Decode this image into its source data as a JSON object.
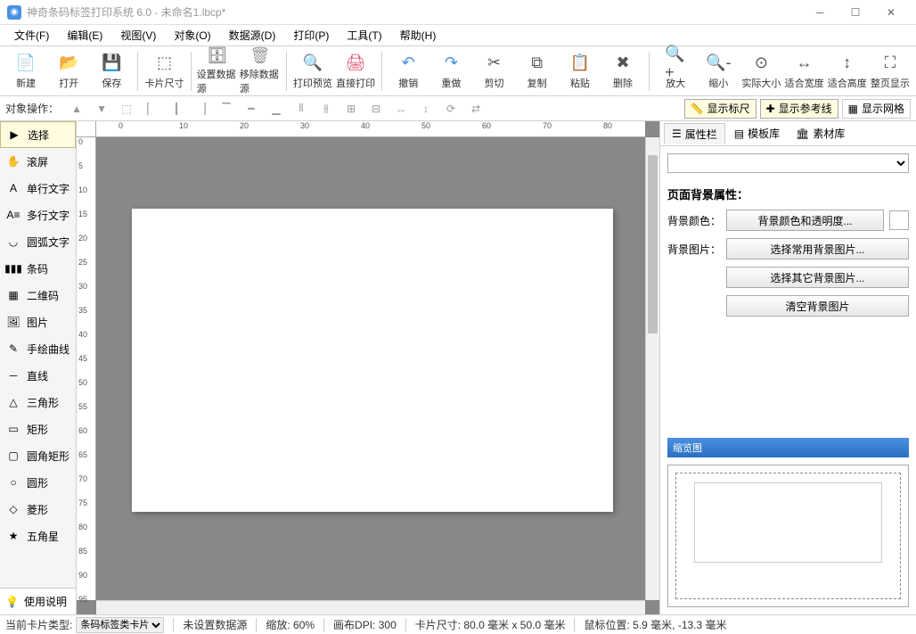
{
  "title": "神奇条码标签打印系统 6.0 - 未命名1.lbcp*",
  "menus": [
    "文件(F)",
    "编辑(E)",
    "视图(V)",
    "对象(O)",
    "数据源(D)",
    "打印(P)",
    "工具(T)",
    "帮助(H)"
  ],
  "toolbar": [
    {
      "id": "new",
      "label": "新建"
    },
    {
      "id": "open",
      "label": "打开"
    },
    {
      "id": "save",
      "label": "保存"
    },
    {
      "sep": true
    },
    {
      "id": "cardsize",
      "label": "卡片尺寸"
    },
    {
      "sep": true
    },
    {
      "id": "setdata",
      "label": "设置数据源"
    },
    {
      "id": "deldata",
      "label": "移除数据源"
    },
    {
      "sep": true
    },
    {
      "id": "preview",
      "label": "打印预览"
    },
    {
      "id": "print",
      "label": "直接打印"
    },
    {
      "sep": true
    },
    {
      "id": "undo",
      "label": "撤销"
    },
    {
      "id": "redo",
      "label": "重做"
    },
    {
      "id": "cut",
      "label": "剪切"
    },
    {
      "id": "copy",
      "label": "复制"
    },
    {
      "id": "paste",
      "label": "粘贴"
    },
    {
      "id": "delete",
      "label": "删除"
    },
    {
      "sep": true
    },
    {
      "id": "zoomin",
      "label": "放大"
    },
    {
      "id": "zoomout",
      "label": "缩小"
    },
    {
      "id": "actual",
      "label": "实际大小"
    },
    {
      "id": "fitw",
      "label": "适合宽度"
    },
    {
      "id": "fith",
      "label": "适合高度"
    },
    {
      "id": "fitpage",
      "label": "整页显示"
    }
  ],
  "subtoolbar": {
    "label": "对象操作：",
    "showRuler": "显示标尺",
    "showGuide": "显示参考线",
    "showGrid": "显示网格"
  },
  "tools": [
    {
      "id": "select",
      "label": "选择",
      "active": true
    },
    {
      "id": "pan",
      "label": "滚屏"
    },
    {
      "id": "text1",
      "label": "单行文字"
    },
    {
      "id": "text2",
      "label": "多行文字"
    },
    {
      "id": "arc",
      "label": "圆弧文字"
    },
    {
      "id": "barcode",
      "label": "条码"
    },
    {
      "id": "qr",
      "label": "二维码"
    },
    {
      "id": "image",
      "label": "图片"
    },
    {
      "id": "draw",
      "label": "手绘曲线"
    },
    {
      "id": "line",
      "label": "直线"
    },
    {
      "id": "triangle",
      "label": "三角形"
    },
    {
      "id": "rect",
      "label": "矩形"
    },
    {
      "id": "roundrect",
      "label": "圆角矩形"
    },
    {
      "id": "circle",
      "label": "圆形"
    },
    {
      "id": "diamond",
      "label": "菱形"
    },
    {
      "id": "star",
      "label": "五角星"
    }
  ],
  "helpLabel": "使用说明",
  "rulerH": [
    "0",
    "10",
    "20",
    "30",
    "40",
    "50",
    "60",
    "70",
    "80"
  ],
  "rulerV": [
    "0",
    "5",
    "10",
    "15",
    "20",
    "25",
    "30",
    "35",
    "40",
    "45",
    "50",
    "55",
    "60",
    "65",
    "70",
    "75",
    "80",
    "85",
    "90",
    "95"
  ],
  "rightPanel": {
    "tabs": [
      "属性栏",
      "模板库",
      "素材库"
    ],
    "sectionTitle": "页面背景属性：",
    "bgColorLabel": "背景颜色：",
    "bgColorBtn": "背景颜色和透明度...",
    "bgImageLabel": "背景图片：",
    "bgCommonBtn": "选择常用背景图片...",
    "bgOtherBtn": "选择其它背景图片...",
    "bgClearBtn": "清空背景图片",
    "overviewTitle": "缩览图"
  },
  "status": {
    "typeLabel": "当前卡片类型:",
    "typeValue": "条码标签类卡片",
    "dataSource": "未设置数据源",
    "zoom": "缩放: 60%",
    "dpi": "画布DPI: 300",
    "cardSize": "卡片尺寸: 80.0 毫米 x 50.0 毫米",
    "mousePos": "鼠标位置: 5.9 毫米, -13.3 毫米"
  }
}
